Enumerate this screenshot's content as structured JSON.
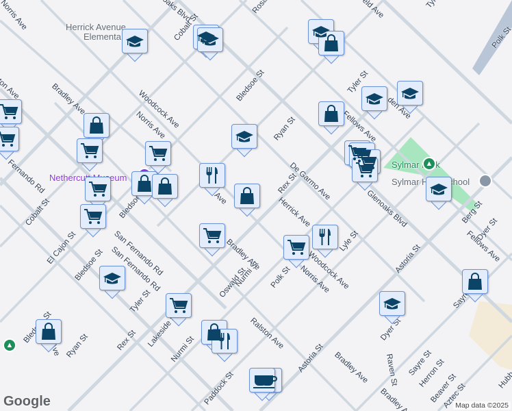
{
  "map": {
    "attribution": "Map data ©2025",
    "logo": "Google"
  },
  "pois": {
    "museum": "Nethercutt Museum",
    "school1": "Herrick Avenue",
    "school1b": "Elementa",
    "park": "Sylmar Park",
    "hs": "Sylmar High School"
  },
  "streets": [
    "Norris Ave",
    "oaks Blvd",
    "Cobalt St",
    "Bradley Ave",
    "Woodcock Ave",
    "Norris Ave",
    "Fernando Rd",
    "Bledsoe St",
    "Tyler St",
    "Ryan St",
    "Rex St",
    "De Garmo Ave",
    "Herrick Ave",
    "Fellows Ave",
    "den Ave",
    "Glenoaks Blvd",
    "Polk St",
    "Cobalt St",
    "El Cajon St",
    "Bledsoe St",
    "San Fernando Rd",
    "San Fernando Rd",
    "Tyler St",
    "Lakeside St",
    "Rex St",
    "Ryan St",
    "Bledsoe St",
    "Nurmi St",
    "Oswald St",
    "Nurmi St",
    "Bradley Ave",
    "Paddock St",
    "Polk St",
    "Lyle St",
    "Woodcock Ave",
    "Norris Ave",
    "Astoria St",
    "Berg St",
    "Dyer St",
    "Fellows Ave",
    "Sayre St",
    "Dyer St",
    "Ralston Ave",
    "Astoria St",
    "Bradley Ave",
    "Raven St",
    "Sayre St",
    "Herron St",
    "Beaver St",
    "Aztec St",
    "Hubb",
    "Rosa",
    "Tyl",
    "eld Ave",
    "Bledsoe St",
    "ton Ave",
    "Ave",
    "Ave",
    "Bradley Ave"
  ],
  "marker_types": {
    "school": "graduation-cap-icon",
    "shop": "shopping-bag-icon",
    "grocery": "shopping-cart-icon",
    "restaurant": "fork-knife-icon",
    "cafe": "coffee-cup-icon"
  },
  "colors": {
    "marker": "#0b4466",
    "marker_bg": "#e3ecfb",
    "park": "#a8e6c0",
    "museum": "#9334e6"
  }
}
